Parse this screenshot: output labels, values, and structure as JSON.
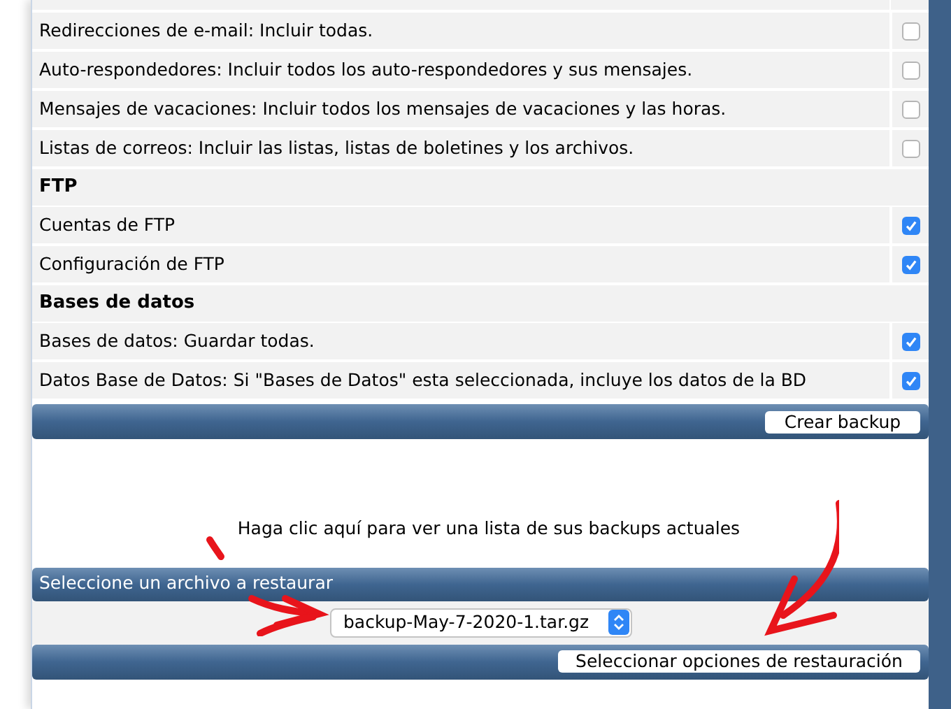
{
  "backup_options": [
    {
      "kind": "option",
      "label": "Redirecciones de e-mail: Incluir todas.",
      "checked": false
    },
    {
      "kind": "option",
      "label": "Auto-respondedores: Incluir todos los auto-respondedores y sus mensajes.",
      "checked": false
    },
    {
      "kind": "option",
      "label": "Mensajes de vacaciones: Incluir todos los mensajes de vacaciones y las horas.",
      "checked": false
    },
    {
      "kind": "option",
      "label": "Listas de correos: Incluir las listas, listas de boletines y los archivos.",
      "checked": false
    },
    {
      "kind": "section",
      "label": "FTP"
    },
    {
      "kind": "option",
      "label": "Cuentas de FTP",
      "checked": true
    },
    {
      "kind": "option",
      "label": "Configuración de FTP",
      "checked": true
    },
    {
      "kind": "section",
      "label": "Bases de datos"
    },
    {
      "kind": "option",
      "label": "Bases de datos: Guardar todas.",
      "checked": true
    },
    {
      "kind": "option",
      "label": "Datos Base de Datos: Si \"Bases de Datos\" esta seleccionada, incluye los datos de la BD",
      "checked": true
    }
  ],
  "create_button": "Crear backup",
  "list_link": "Haga clic aquí para ver una lista de sus backups actuales",
  "restore": {
    "title": "Seleccione un archivo a restaurar",
    "file": "backup-May-7-2020-1.tar.gz",
    "button": "Seleccionar opciones de restauración"
  }
}
